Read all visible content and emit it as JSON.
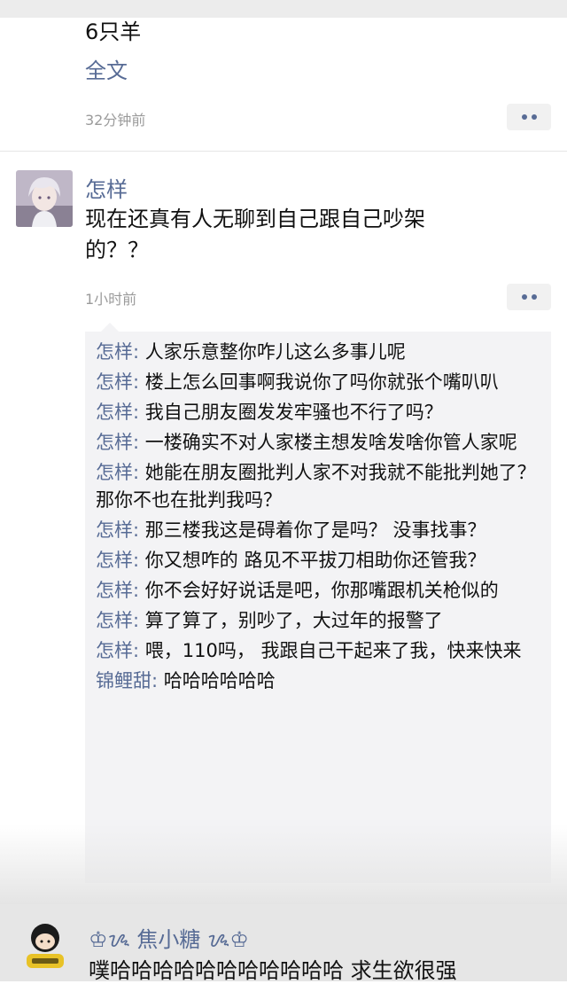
{
  "previous_post": {
    "text_tail": "6只羊",
    "full_text_link": "全文",
    "time": "32分钟前"
  },
  "post": {
    "author": "怎样",
    "text": "现在还真有人无聊到自己跟自己吵架的？？",
    "text_line1": "现在还真有人无聊到自己跟自己吵架",
    "text_line2": "的？？",
    "time": "1小时前"
  },
  "comments": [
    {
      "name": "怎样",
      "sep": ": ",
      "text": "人家乐意整你咋儿这么多事儿呢"
    },
    {
      "name": "怎样",
      "sep": ": ",
      "text": "楼上怎么回事啊我说你了吗你就张个嘴叭叭"
    },
    {
      "name": "怎样",
      "sep": ": ",
      "text": "我自己朋友圈发发牢骚也不行了吗？"
    },
    {
      "name": "怎样",
      "sep": ": ",
      "text": "一楼确实不对人家楼主想发啥发啥你管人家呢"
    },
    {
      "name": "怎样",
      "sep": ": ",
      "text": "她能在朋友圈批判人家不对我就不能批判她了？那你不也在批判我吗？"
    },
    {
      "name": "怎样",
      "sep": ": ",
      "text": "那三楼我这是碍着你了是吗？ 没事找事？"
    },
    {
      "name": "怎样",
      "sep": ": ",
      "text": "你又想咋的 路见不平拔刀相助你还管我？"
    },
    {
      "name": "怎样",
      "sep": ": ",
      "text": "你不会好好说话是吧，你那嘴跟机关枪似的"
    },
    {
      "name": "怎样",
      "sep": ": ",
      "text": "算了算了，别吵了，大过年的报警了"
    },
    {
      "name": "怎样",
      "sep": ": ",
      "text": "喂，110吗， 我跟自己干起来了我，快来快来"
    },
    {
      "name": "锦鲤甜",
      "sep": ": ",
      "text": "哈哈哈哈哈哈"
    }
  ],
  "next_post": {
    "author": "焦小糖",
    "text": "噗哈哈哈哈哈哈哈哈哈哈哈  求生欲很强"
  },
  "colors": {
    "link": "#576b95",
    "comment_bg": "#f3f3f5",
    "time_gray": "#9b9b9b"
  },
  "icons": {
    "more": "more-dots-icon",
    "avatar_author": "anime-boy-avatar",
    "avatar_next": "cartoon-avatar"
  }
}
